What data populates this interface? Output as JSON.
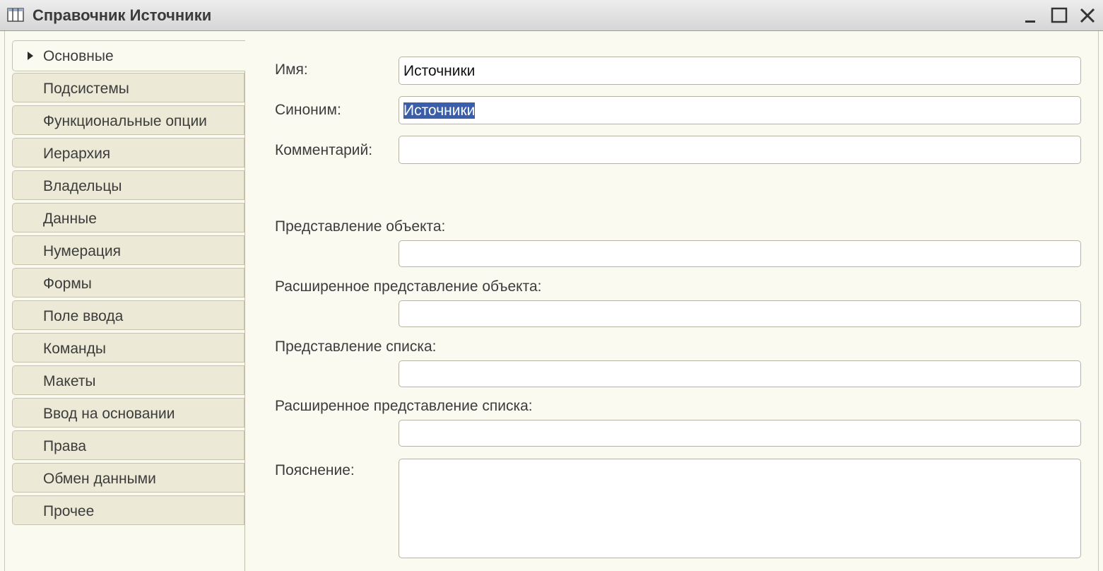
{
  "window": {
    "title": "Справочник Источники",
    "icon": "table-icon",
    "controls": [
      "minimize-icon",
      "maximize-icon",
      "close-icon"
    ]
  },
  "tabs": [
    {
      "label": "Основные",
      "active": true
    },
    {
      "label": "Подсистемы"
    },
    {
      "label": "Функциональные опции"
    },
    {
      "label": "Иерархия"
    },
    {
      "label": "Владельцы"
    },
    {
      "label": "Данные"
    },
    {
      "label": "Нумерация"
    },
    {
      "label": "Формы"
    },
    {
      "label": "Поле ввода"
    },
    {
      "label": "Команды"
    },
    {
      "label": "Макеты"
    },
    {
      "label": "Ввод на основании"
    },
    {
      "label": "Права"
    },
    {
      "label": "Обмен данными"
    },
    {
      "label": "Прочее"
    }
  ],
  "form": {
    "name": {
      "label": "Имя:",
      "value": "Источники"
    },
    "synonym": {
      "label": "Синоним:",
      "value": "Источники",
      "selected": true
    },
    "comment": {
      "label": "Комментарий:",
      "value": ""
    },
    "object_presentation": {
      "label": "Представление объекта:",
      "value": ""
    },
    "extended_object_presentation": {
      "label": "Расширенное представление объекта:",
      "value": ""
    },
    "list_presentation": {
      "label": "Представление списка:",
      "value": ""
    },
    "extended_list_presentation": {
      "label": "Расширенное представление списка:",
      "value": ""
    },
    "explanation": {
      "label": "Пояснение:",
      "value": ""
    }
  },
  "colors": {
    "background": "#fbfaf1",
    "tab_background": "#ecead7",
    "selection": "#3a5eaa"
  }
}
